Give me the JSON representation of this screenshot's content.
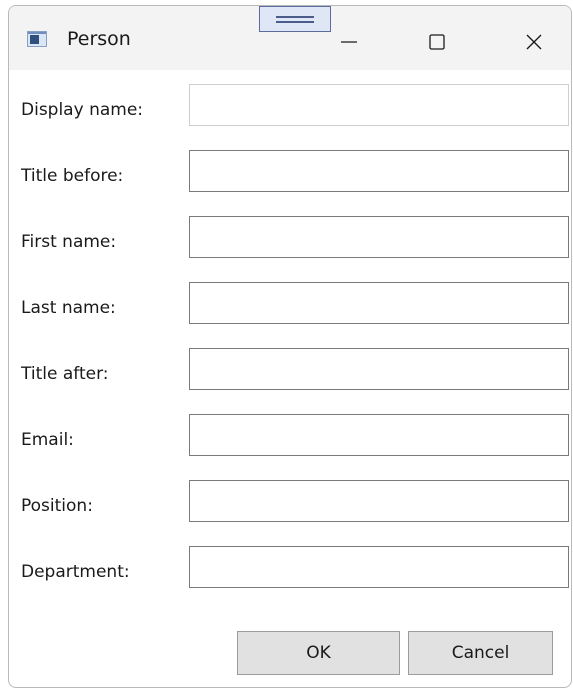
{
  "window": {
    "title": "Person",
    "app_icon": "window-app-icon",
    "controls": {
      "minimize_icon": "minimize-icon",
      "maximize_icon": "maximize-icon",
      "close_icon": "close-icon"
    }
  },
  "form": {
    "fields": [
      {
        "label": "Display name:",
        "value": ""
      },
      {
        "label": "Title before:",
        "value": ""
      },
      {
        "label": "First name:",
        "value": ""
      },
      {
        "label": "Last name:",
        "value": ""
      },
      {
        "label": "Title after:",
        "value": ""
      },
      {
        "label": "Email:",
        "value": ""
      },
      {
        "label": "Position:",
        "value": ""
      },
      {
        "label": "Department:",
        "value": ""
      }
    ]
  },
  "buttons": {
    "ok_label": "OK",
    "cancel_label": "Cancel"
  },
  "colors": {
    "titlebar_bg": "#f3f3f3",
    "button_bg": "#e1e1e1",
    "input_border": "#7a7a7a"
  }
}
